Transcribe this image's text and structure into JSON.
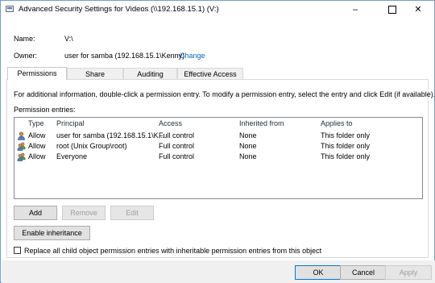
{
  "window": {
    "title": "Advanced Security Settings for Videos (\\\\192.168.15.1) (V:)",
    "minimize_glyph": "–",
    "close_glyph": "✕"
  },
  "info": {
    "name_label": "Name:",
    "name_value": "V:\\",
    "owner_label": "Owner:",
    "owner_value": "user for samba (192.168.15.1\\Kenny)",
    "change_link": "Change"
  },
  "tabs": [
    {
      "label": "Permissions",
      "active": true
    },
    {
      "label": "Share",
      "active": false
    },
    {
      "label": "Auditing",
      "active": false
    },
    {
      "label": "Effective Access",
      "active": false
    }
  ],
  "permissions": {
    "info_text": "For additional information, double-click a permission entry. To modify a permission entry, select the entry and click Edit (if available).",
    "entries_label": "Permission entries:",
    "columns": [
      "Type",
      "Principal",
      "Access",
      "Inherited from",
      "Applies to"
    ],
    "rows": [
      {
        "icon": "user-icon",
        "type": "Allow",
        "principal": "user for samba (192.168.15.1\\K...",
        "access": "Full control",
        "inherited": "None",
        "applies": "This folder only"
      },
      {
        "icon": "group-icon",
        "type": "Allow",
        "principal": "root (Unix Group\\root)",
        "access": "Full control",
        "inherited": "None",
        "applies": "This folder only"
      },
      {
        "icon": "group-icon",
        "type": "Allow",
        "principal": "Everyone",
        "access": "Full control",
        "inherited": "None",
        "applies": "This folder only"
      }
    ],
    "add_button": "Add",
    "remove_button": "Remove",
    "edit_button": "Edit",
    "enable_inheritance_button": "Enable inheritance",
    "replace_checkbox_label": "Replace all child object permission entries with inheritable permission entries from this object",
    "replace_checked": false
  },
  "footer": {
    "ok": "OK",
    "cancel": "Cancel",
    "apply": "Apply"
  },
  "colors": {
    "accent": "#0078d7",
    "link": "#0066cc",
    "disabled_text": "#a0a0a0"
  }
}
